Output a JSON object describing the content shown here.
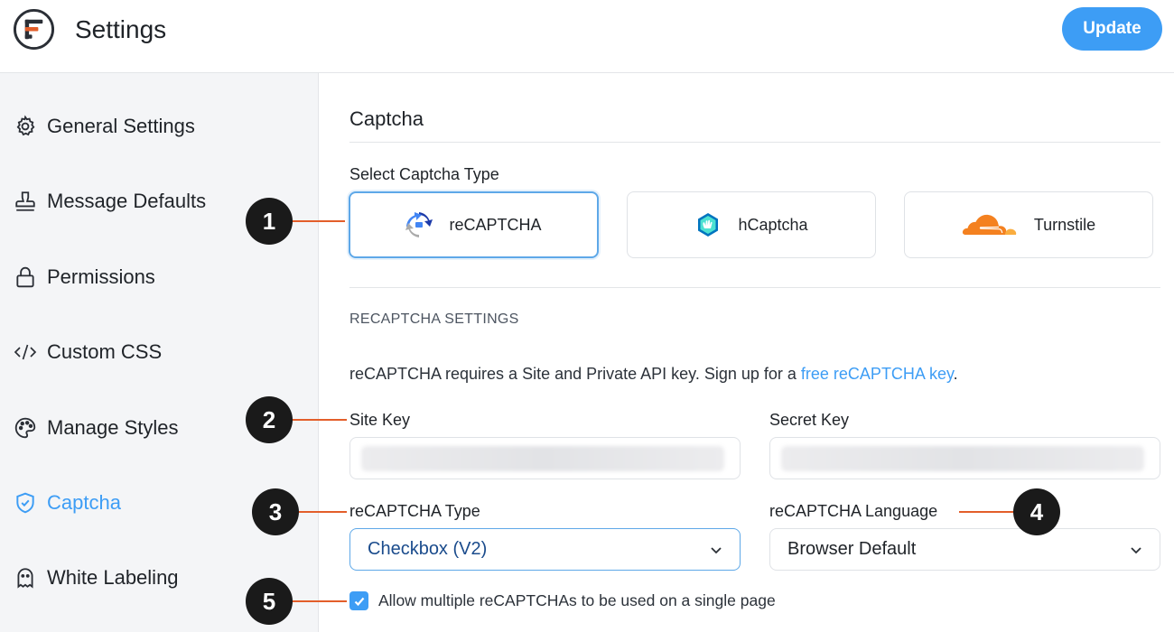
{
  "header": {
    "title": "Settings",
    "update_label": "Update"
  },
  "sidebar": {
    "items": [
      {
        "label": "General Settings",
        "icon": "gear-icon"
      },
      {
        "label": "Message Defaults",
        "icon": "stamp-icon"
      },
      {
        "label": "Permissions",
        "icon": "lock-icon"
      },
      {
        "label": "Custom CSS",
        "icon": "code-icon"
      },
      {
        "label": "Manage Styles",
        "icon": "palette-icon"
      },
      {
        "label": "Captcha",
        "icon": "shield-check-icon",
        "active": true
      },
      {
        "label": "White Labeling",
        "icon": "ghost-icon"
      }
    ]
  },
  "main": {
    "section_title": "Captcha",
    "select_type_label": "Select Captcha Type",
    "captcha_types": [
      {
        "label": "reCAPTCHA",
        "icon": "recaptcha-icon",
        "selected": true
      },
      {
        "label": "hCaptcha",
        "icon": "hcaptcha-icon",
        "selected": false
      },
      {
        "label": "Turnstile",
        "icon": "cloudflare-icon",
        "selected": false
      }
    ],
    "settings_heading": "RECAPTCHA SETTINGS",
    "description_prefix": "reCAPTCHA requires a Site and Private API key. Sign up for a ",
    "description_link": "free reCAPTCHA key",
    "description_suffix": ".",
    "site_key_label": "Site Key",
    "secret_key_label": "Secret Key",
    "recaptcha_type_label": "reCAPTCHA Type",
    "recaptcha_type_value": "Checkbox (V2)",
    "recaptcha_language_label": "reCAPTCHA Language",
    "recaptcha_language_value": "Browser Default",
    "multiple_checkbox_label": "Allow multiple reCAPTCHAs to be used on a single page",
    "multiple_checked": true
  },
  "callouts": [
    "1",
    "2",
    "3",
    "4",
    "5"
  ],
  "colors": {
    "accent": "#3d9df5",
    "callout_line": "#e35e2a",
    "callout_bg": "#1a1a1a"
  }
}
